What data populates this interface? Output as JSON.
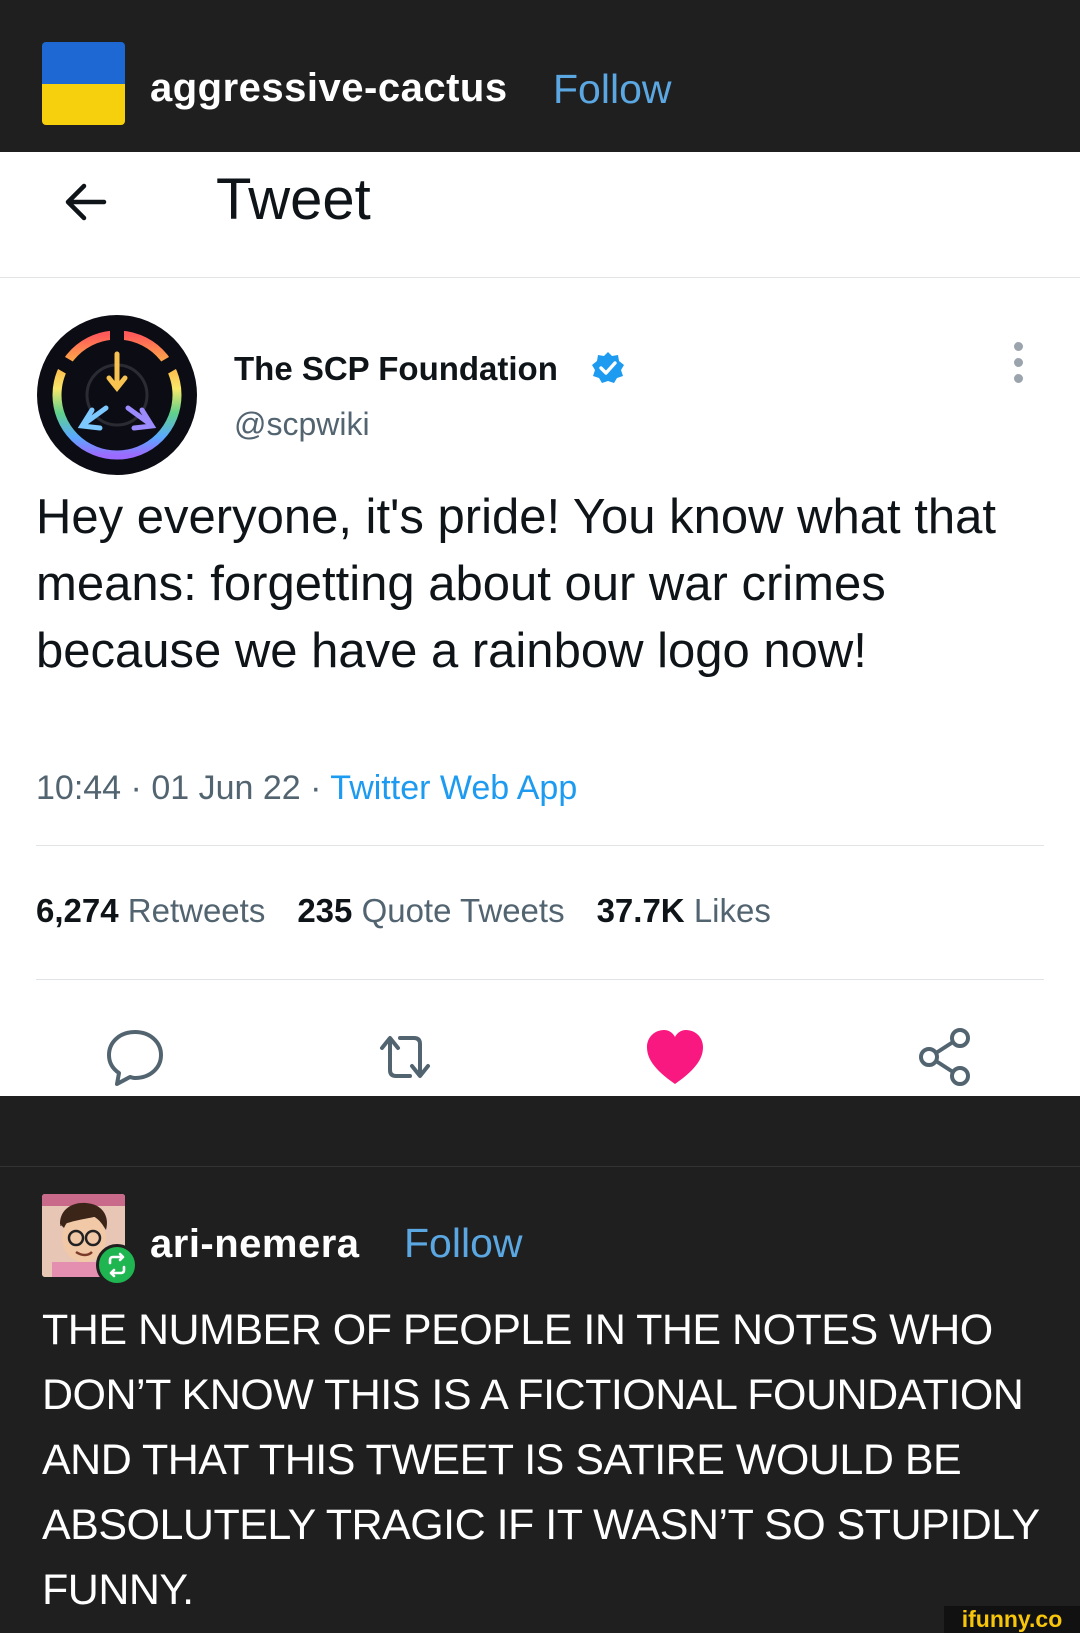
{
  "post1": {
    "username": "aggressive-cactus",
    "follow_label": "Follow",
    "flag_colors": [
      "#1d68d3",
      "#f6cf0d"
    ]
  },
  "tweet": {
    "header_title": "Tweet",
    "back_icon": "arrow-left-icon",
    "display_name": "The SCP Foundation",
    "verified_icon": "verified-badge-icon",
    "handle": "@scpwiki",
    "more_icon": "more-vertical-icon",
    "text": "Hey everyone, it's pride! You know what that means: forgetting about our war crimes because we have a rainbow logo now!",
    "time": "10:44",
    "date": "01 Jun 22",
    "source": "Twitter Web App",
    "stats": {
      "retweets_count": "6,274",
      "retweets_label": "Retweets",
      "quotes_count": "235",
      "quotes_label": "Quote Tweets",
      "likes_count": "37.7K",
      "likes_label": "Likes"
    },
    "actions": [
      "reply-icon",
      "retweet-icon",
      "like-heart-icon",
      "share-icon"
    ],
    "like_color": "#f91880",
    "accent": "#1d9bf0"
  },
  "post2": {
    "username": "ari-nemera",
    "follow_label": "Follow",
    "reblog_icon": "reblog-icon",
    "text": "THE NUMBER OF PEOPLE IN THE NOTES WHO DON’T KNOW THIS IS A FICTIONAL FOUNDATION AND THAT THIS TWEET IS SATIRE WOULD BE  ABSOLUTELY TRAGIC IF IT WASN’T SO STUPIDLY FUNNY."
  },
  "watermark": "ifunny.co"
}
